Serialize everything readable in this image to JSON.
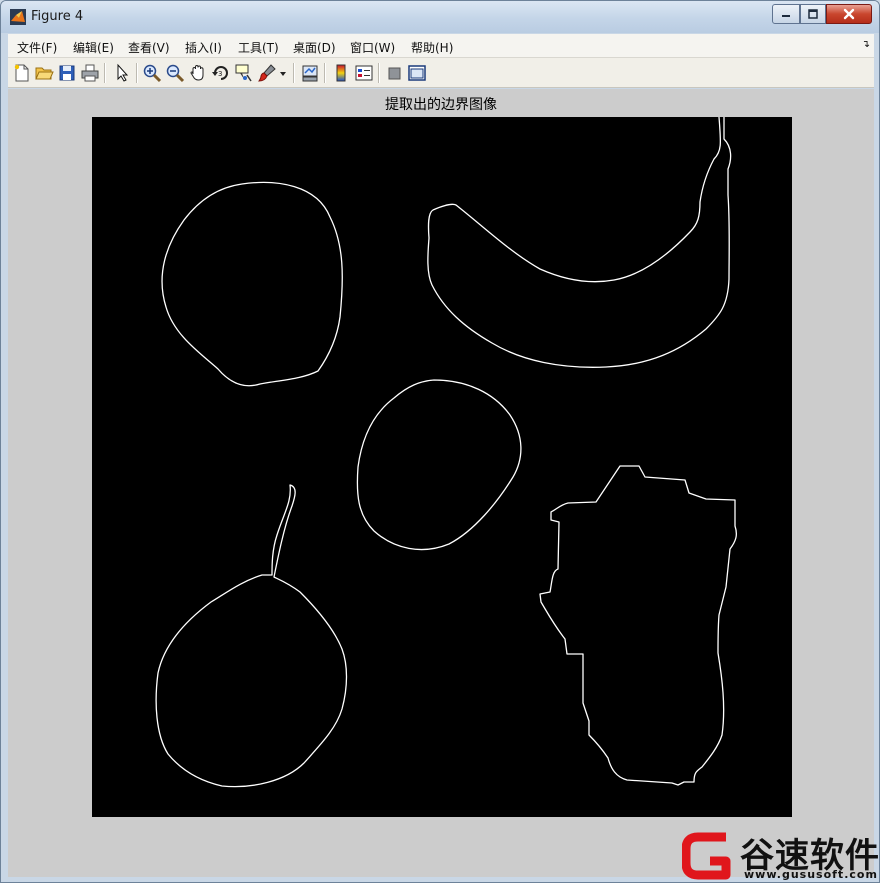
{
  "window": {
    "title": "Figure 4",
    "controls": {
      "minimize": "minimize",
      "maximize": "maximize",
      "close": "close"
    }
  },
  "menu": {
    "items": [
      "文件(F)",
      "编辑(E)",
      "查看(V)",
      "插入(I)",
      "工具(T)",
      "桌面(D)",
      "窗口(W)",
      "帮助(H)"
    ]
  },
  "toolbar": {
    "buttons": [
      "new-figure-icon",
      "open-file-icon",
      "save-icon",
      "print-icon",
      "pointer-icon",
      "zoom-in-icon",
      "zoom-out-icon",
      "pan-hand-icon",
      "rotate-3d-icon",
      "data-cursor-icon",
      "brush-icon",
      "link-plot-icon",
      "colorbar-icon",
      "legend-icon",
      "hide-plot-tools-icon",
      "show-plot-tools-icon"
    ]
  },
  "figure": {
    "axes_title": "提取出的边界图像",
    "background_color": "#cccccc",
    "image_background": "#000000",
    "edge_color": "#ffffff"
  },
  "watermark": {
    "brand": "谷速软件",
    "url": "www.gususoft.com",
    "logo_color": "#e0161c"
  }
}
